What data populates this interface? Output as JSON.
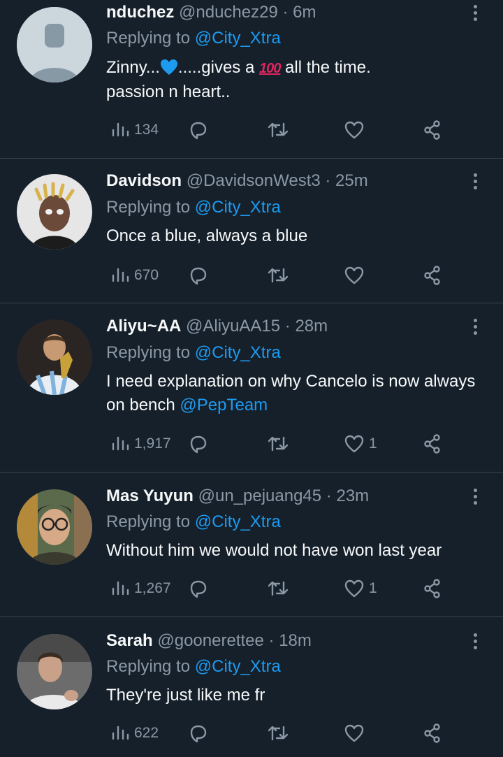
{
  "tweets": [
    {
      "name": "nduchez",
      "handle": "@nduchez29",
      "dot": " · ",
      "time": "6m",
      "replying_prefix": "Replying to ",
      "replying_to": "@City_Xtra",
      "text_part1": "Zinny...",
      "heart_emoji": "blue-heart",
      "text_part2": ".....gives a ",
      "emoji_100": "100",
      "text_part3": " all the time.",
      "text_line2": "passion n heart..",
      "views": "134",
      "likes": ""
    },
    {
      "name": "Davidson",
      "handle": "@DavidsonWest3",
      "dot": " · ",
      "time": "25m",
      "replying_prefix": "Replying to ",
      "replying_to": "@City_Xtra",
      "text": "Once a blue, always a blue",
      "views": "670",
      "likes": ""
    },
    {
      "name": "Aliyu~AA",
      "handle": "@AliyuAA15",
      "dot": " · ",
      "time": "28m",
      "replying_prefix": "Replying to ",
      "replying_to": "@City_Xtra",
      "text": "I need explanation on why Cancelo is now always on bench ",
      "text_mention": "@PepTeam",
      "views": "1,917",
      "likes": "1"
    },
    {
      "name": "Mas Yuyun",
      "handle": "@un_pejuang45",
      "dot": " · ",
      "time": "23m",
      "replying_prefix": "Replying to ",
      "replying_to": "@City_Xtra",
      "text": "Without him we would not have won last year",
      "views": "1,267",
      "likes": "1"
    },
    {
      "name": "Sarah",
      "handle": "@goonerettee",
      "dot": " · ",
      "time": "18m",
      "replying_prefix": "Replying to ",
      "replying_to": "@City_Xtra",
      "text": "They're just like me fr",
      "views": "622",
      "likes": ""
    }
  ],
  "colors": {
    "background": "#15202b",
    "text": "#f7f9f9",
    "muted": "#8b98a5",
    "accent": "#1d9bf0",
    "divider": "#38444d"
  }
}
